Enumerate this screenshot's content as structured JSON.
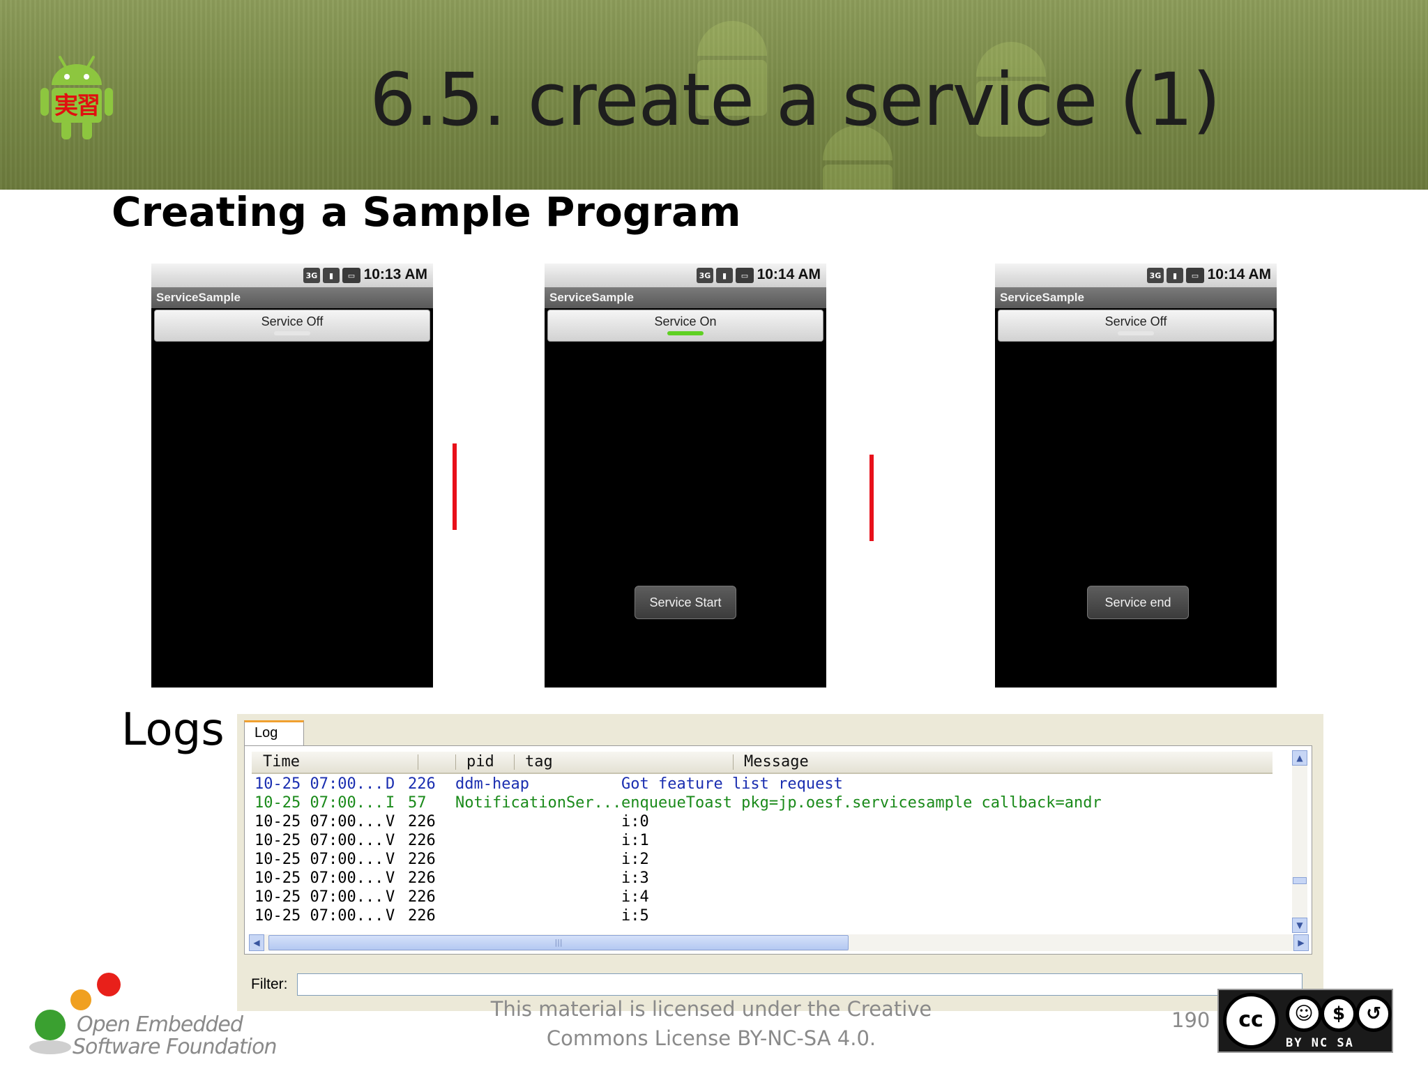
{
  "slide": {
    "title": "6.5. create a service (1)",
    "subtitle": "Creating a Sample Program",
    "logo_text": "実習",
    "page_number": "190",
    "license_line1": "This material is licensed under the Creative",
    "license_line2": "Commons License BY-NC-SA 4.0.",
    "oesf_line1": "Open Embedded",
    "oesf_line2": "Software Foundation",
    "cc_main": "cc",
    "cc_labels": "BY NC SA",
    "colors": {
      "banner": "#7a8a48",
      "red_bar": "#e8101a",
      "toggle_on": "#5fd023"
    }
  },
  "phones": [
    {
      "time": "10:13 AM",
      "app_name": "ServiceSample",
      "toggle_label": "Service Off",
      "toggle_on": false,
      "button_label": ""
    },
    {
      "time": "10:14 AM",
      "app_name": "ServiceSample",
      "toggle_label": "Service On",
      "toggle_on": true,
      "button_label": "Service Start"
    },
    {
      "time": "10:14 AM",
      "app_name": "ServiceSample",
      "toggle_label": "Service Off",
      "toggle_on": false,
      "button_label": "Service end"
    }
  ],
  "status_icons": [
    "3G",
    "signal-icon",
    "battery-icon"
  ],
  "logs": {
    "section_label": "Logs",
    "tab_label": "Log",
    "columns": {
      "time": "Time",
      "pid": "pid",
      "tag": "tag",
      "message": "Message"
    },
    "filter_label": "Filter:",
    "filter_value": "",
    "rows": [
      {
        "time": "10-25 07:00...",
        "level": "D",
        "pid": "226",
        "tag": "ddm-heap",
        "message": "Got feature list request",
        "color": "#1a2eb0"
      },
      {
        "time": "10-25 07:00...",
        "level": "I",
        "pid": "57",
        "tag": "NotificationSer...",
        "message": "enqueueToast pkg=jp.oesf.servicesample callback=andr",
        "color": "#1a8a1a"
      },
      {
        "time": "10-25 07:00...",
        "level": "V",
        "pid": "226",
        "tag": "",
        "message": "i:0",
        "color": "#000000"
      },
      {
        "time": "10-25 07:00...",
        "level": "V",
        "pid": "226",
        "tag": "",
        "message": "i:1",
        "color": "#000000"
      },
      {
        "time": "10-25 07:00...",
        "level": "V",
        "pid": "226",
        "tag": "",
        "message": "i:2",
        "color": "#000000"
      },
      {
        "time": "10-25 07:00...",
        "level": "V",
        "pid": "226",
        "tag": "",
        "message": "i:3",
        "color": "#000000"
      },
      {
        "time": "10-25 07:00...",
        "level": "V",
        "pid": "226",
        "tag": "",
        "message": "i:4",
        "color": "#000000"
      },
      {
        "time": "10-25 07:00...",
        "level": "V",
        "pid": "226",
        "tag": "",
        "message": "i:5",
        "color": "#000000"
      }
    ]
  }
}
